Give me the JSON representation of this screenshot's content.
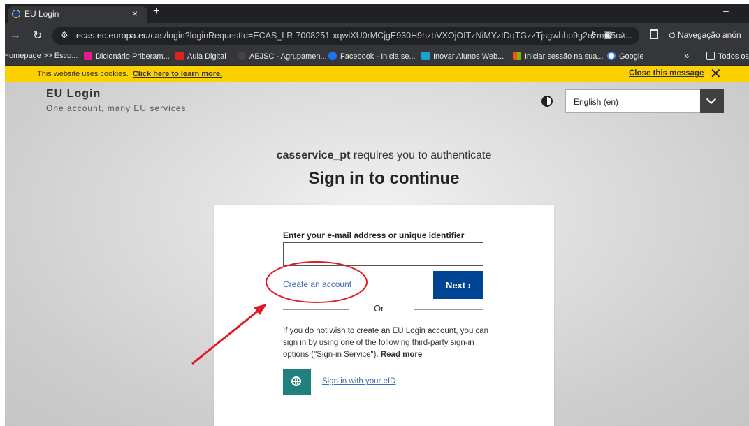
{
  "browser": {
    "tab_title": "EU Login",
    "tab_close": "×",
    "new_tab": "+",
    "minimize": "–",
    "url_host": "ecas.ec.europa.eu",
    "url_rest": "/cas/login?loginRequestId=ECAS_LR-7008251-xqwiXU0rMCjgE930H9hzbVXOjOITzNiMYztDqTGzzTjsgwhhp9g2ezmG5oz...",
    "incognito_label": "Navegação anón"
  },
  "bookmarks": [
    {
      "label": "Homepage >> Esco...",
      "color": ""
    },
    {
      "label": "Dicionário Priberam...",
      "color": "#e31b8b"
    },
    {
      "label": "Aula Digital",
      "color": "#d9251d"
    },
    {
      "label": "AEJSC - Agrupamen...",
      "color": "#444444"
    },
    {
      "label": "Facebook - Inicia se...",
      "color": "#1877f2"
    },
    {
      "label": "Inovar Alunos Web...",
      "color": "#1aa3c9"
    },
    {
      "label": "Iniciar sessão na sua...",
      "color": "#f25022"
    },
    {
      "label": "Google",
      "color": "#ffffff"
    },
    {
      "label": "»",
      "color": ""
    },
    {
      "label": "Todos os",
      "color": ""
    }
  ],
  "cookie": {
    "text": "This website uses cookies.",
    "link": "Click here to learn more.",
    "close": "Close this message",
    "close_x": "✕"
  },
  "header": {
    "brand": "EU Login",
    "tagline": "One account, many EU services",
    "language": "English (en)"
  },
  "auth": {
    "service": "casservice_pt",
    "text": " requires you to authenticate",
    "heading": "Sign in to continue"
  },
  "form": {
    "email_label": "Enter your e-mail address or unique identifier",
    "email_value": "",
    "create_account": "Create an account",
    "next": "Next ›",
    "or": "Or",
    "info": "If you do not wish to create an EU Login account, you can sign in by using one of the following third-party sign-in options (\"Sign-in Service\"). ",
    "read_more": "Read more",
    "eid_link": "Sign in with your eID"
  },
  "colors": {
    "cookie_banner": "#fdd000",
    "primary_button": "#004494",
    "eid_button": "#207f7f",
    "annotation": "#e01b24"
  }
}
